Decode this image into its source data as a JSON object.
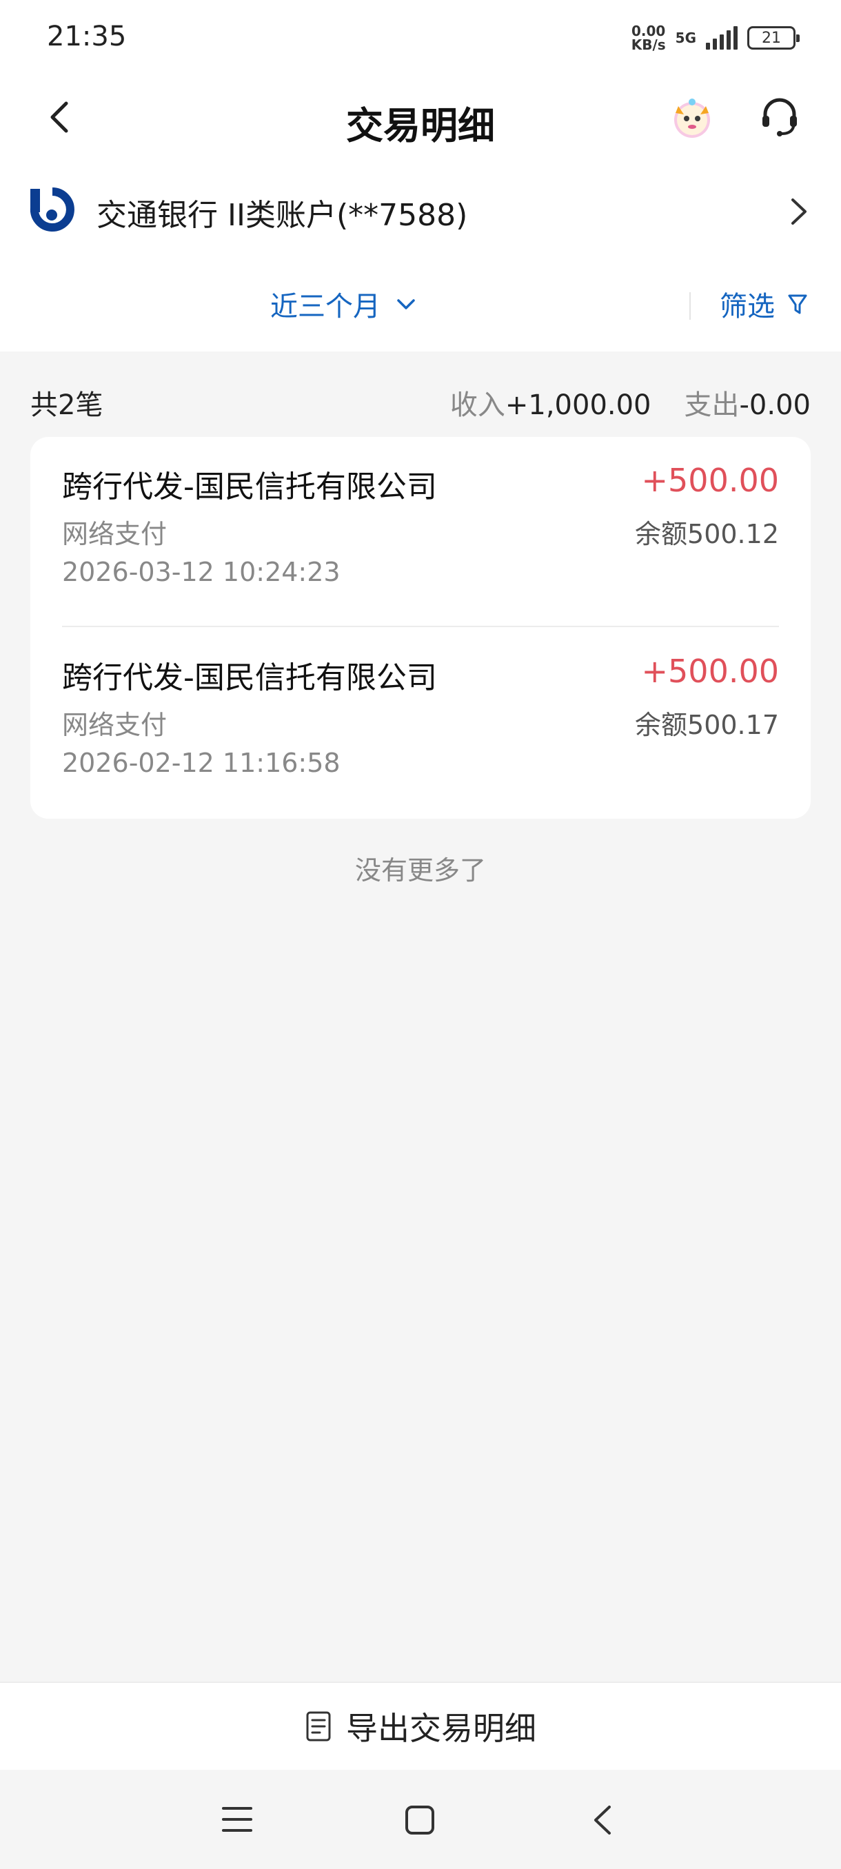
{
  "status_bar": {
    "time": "21:35",
    "net_speed_value": "0.00",
    "net_speed_unit": "KB/s",
    "network": "5G",
    "battery": "21"
  },
  "header": {
    "title": "交易明细",
    "back_icon": "chevron-left-icon",
    "mascot_icon": "mascot-icon",
    "service_icon": "headset-icon"
  },
  "account": {
    "label": "交通银行 II类账户(**7588)",
    "brand_color": "#0b3d91"
  },
  "filter": {
    "period": "近三个月",
    "filter_label": "筛选",
    "accent_color": "#1565c0"
  },
  "summary": {
    "count": "共2笔",
    "income_label": "收入",
    "income_value": "+1,000.00",
    "expense_label": "支出",
    "expense_value": "-0.00"
  },
  "transactions": [
    {
      "title": "跨行代发-国民信托有限公司",
      "amount": "+500.00",
      "channel": "网络支付",
      "balance": "余额500.12",
      "time": "2026-03-12 10:24:23"
    },
    {
      "title": "跨行代发-国民信托有限公司",
      "amount": "+500.00",
      "channel": "网络支付",
      "balance": "余额500.17",
      "time": "2026-02-12 11:16:58"
    }
  ],
  "no_more": "没有更多了",
  "export": {
    "label": "导出交易明细"
  },
  "colors": {
    "income_red": "#e0505a",
    "background": "#f5f5f5"
  }
}
